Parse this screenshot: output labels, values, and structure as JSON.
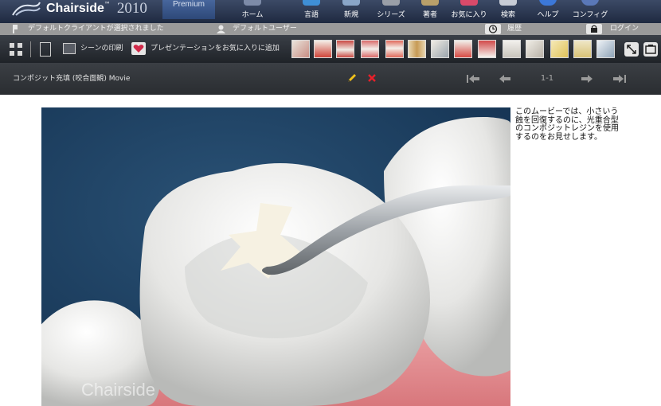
{
  "app": {
    "name": "Chairside",
    "version_year": "2010",
    "edition": "Premium"
  },
  "nav": [
    {
      "label": "ホーム",
      "icon": "home-icon"
    },
    {
      "label": "言語",
      "icon": "globe-icon"
    },
    {
      "label": "新規",
      "icon": "new-icon"
    },
    {
      "label": "シリーズ",
      "icon": "film-icon"
    },
    {
      "label": "著者",
      "icon": "author-icon"
    },
    {
      "label": "お気に入り",
      "icon": "heart-icon"
    },
    {
      "label": "検索",
      "icon": "search-icon"
    },
    {
      "label": "ヘルプ",
      "icon": "help-icon"
    },
    {
      "label": "コンフィグ",
      "icon": "gear-icon"
    }
  ],
  "status": {
    "client": "デフォルトクライアントが選択されました",
    "user": "デフォルトユーザー",
    "history": "履歴",
    "login": "ログイン"
  },
  "toolbar": {
    "print_scene": "シーンの印刷",
    "add_favorite": "プレゼンテーションをお気に入りに追加"
  },
  "title_bar": {
    "title": "コンポジット充填 (咬合面観) Movie",
    "pager": "1-1"
  },
  "content": {
    "description": "このムービーでは、小さいう蝕を回復するのに、光重合型のコンポジットレジンを使用するのをお見せします。",
    "watermark": "Chairside"
  },
  "colors": {
    "accent_red": "#e8202a",
    "pencil_yellow": "#f2c21a",
    "thumb_highlight": "#d0453a"
  }
}
